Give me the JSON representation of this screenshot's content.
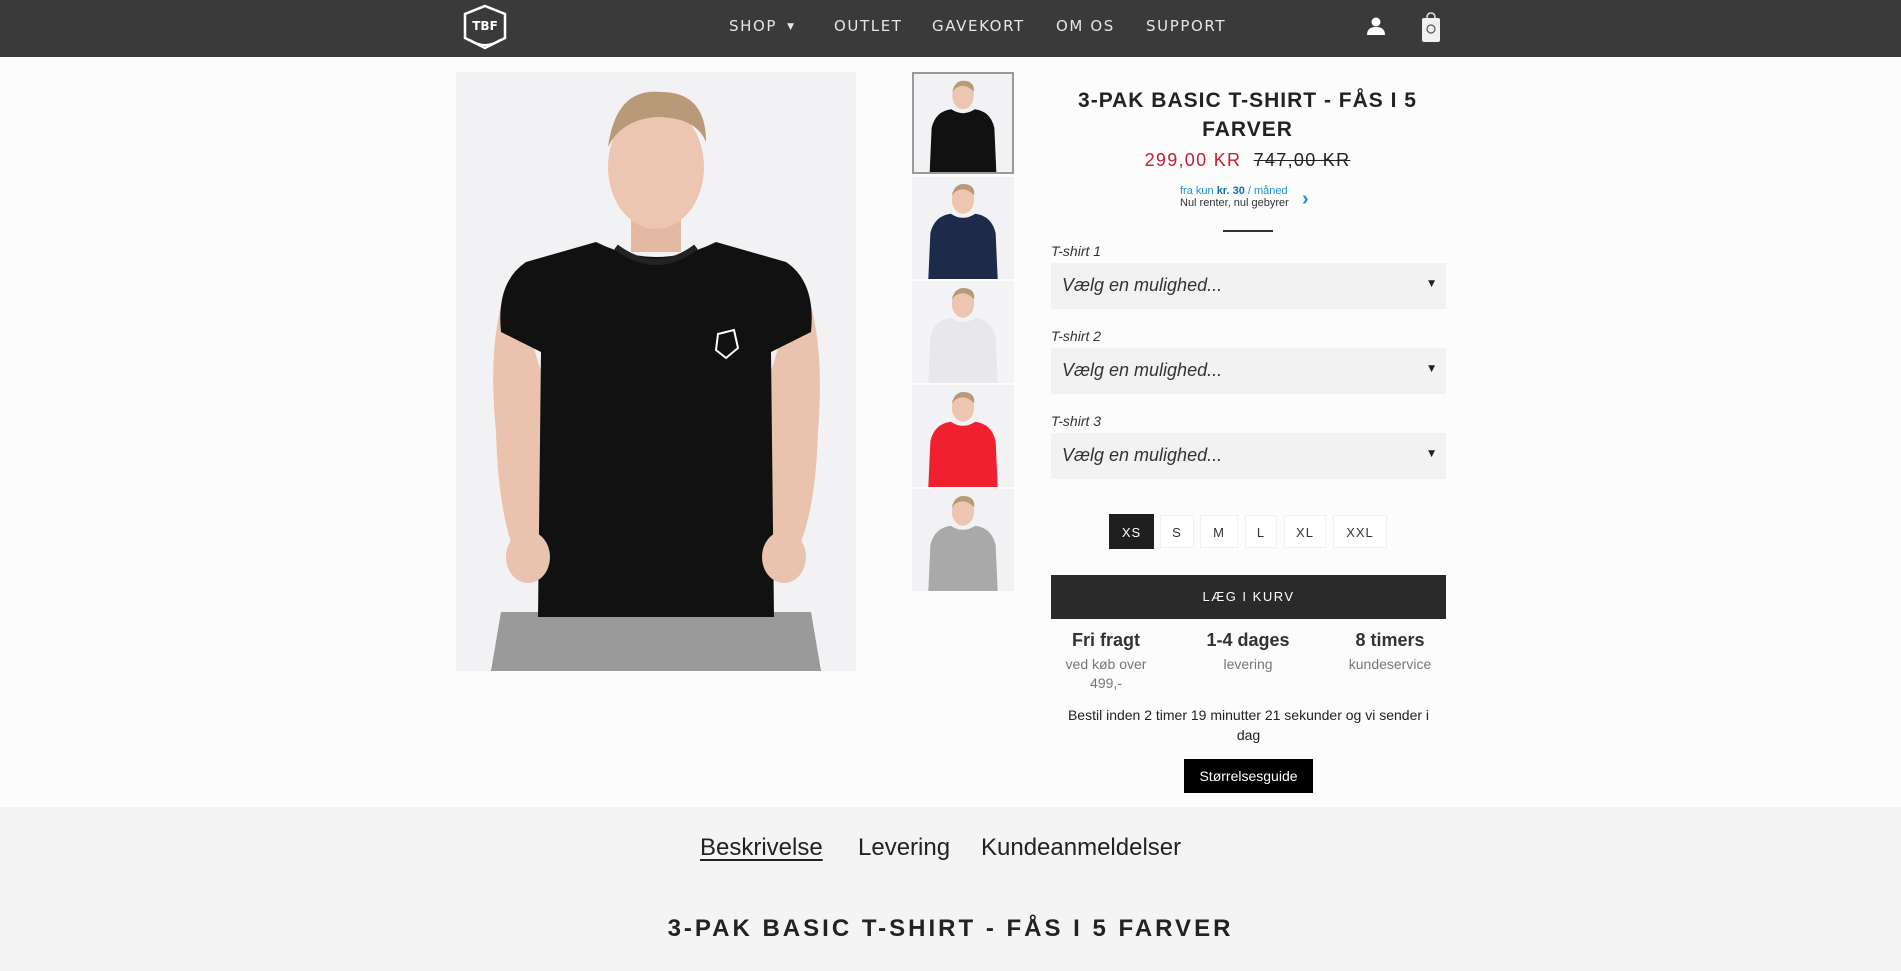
{
  "header": {
    "nav": [
      {
        "label": "SHOP",
        "has_dropdown": true
      },
      {
        "label": "OUTLET"
      },
      {
        "label": "GAVEKORT"
      },
      {
        "label": "OM OS"
      },
      {
        "label": "SUPPORT"
      }
    ],
    "logo_text": "TBF"
  },
  "product": {
    "title": "3-PAK BASIC T-SHIRT - FÅS I 5 FARVER",
    "price_new": "299,00 KR",
    "price_old": "747,00 KR",
    "finance": {
      "prefix": "fra kun ",
      "amount": "kr. 30",
      "suffix": " / måned",
      "line2": "Nul renter, nul gebyrer"
    },
    "options": [
      {
        "label": "T-shirt 1",
        "value": "Vælg en mulighed..."
      },
      {
        "label": "T-shirt 2",
        "value": "Vælg en mulighed..."
      },
      {
        "label": "T-shirt 3",
        "value": "Vælg en mulighed..."
      }
    ],
    "sizes": [
      "XS",
      "S",
      "M",
      "L",
      "XL",
      "XXL"
    ],
    "selected_size": "XS",
    "add_to_cart": "LÆG I KURV",
    "usps": [
      {
        "title": "Fri fragt",
        "sub": "ved køb over 499,-"
      },
      {
        "title": "1-4 dages",
        "sub": "levering"
      },
      {
        "title": "8 timers",
        "sub": "kundeservice"
      }
    ],
    "countdown": "Bestil inden 2 timer 19 minutter 21 sekunder og vi sender i dag",
    "size_guide": "Størrelsesguide",
    "thumbnail_colors": [
      "#111111",
      "#1d2a4a",
      "#f2f2f2",
      "#f0202e",
      "#a9a9a9"
    ]
  },
  "tabs": {
    "items": [
      "Beskrivelse",
      "Levering",
      "Kundeanmeldelser"
    ],
    "active": "Beskrivelse",
    "description_title": "3-PAK BASIC T-SHIRT - FÅS I 5 FARVER"
  }
}
